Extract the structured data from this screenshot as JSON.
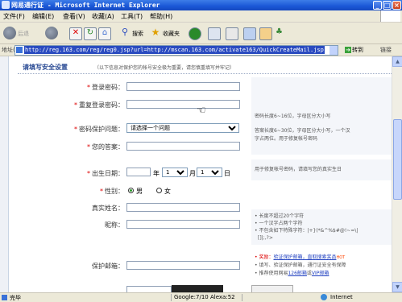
{
  "window": {
    "title": "网易通行证 - Microsoft Internet Explorer"
  },
  "menu": [
    "文件(F)",
    "编辑(E)",
    "查看(V)",
    "收藏(A)",
    "工具(T)",
    "帮助(H)"
  ],
  "toolbar": {
    "back": "后退",
    "search": "搜索",
    "favorites": "收藏夹"
  },
  "address": {
    "label": "地址(D)",
    "url": "http://reg.163.com/reg/reg0.jsp?url=http://mscan.163.com/activate163/QuickCreateMail.jsp",
    "go": "转到",
    "links": "链接"
  },
  "form": {
    "section_title": "请填写安全设置",
    "section_sub": "（以下信息对保护您的帐号安全极为重要，请您慎重填写并牢记）",
    "login_pwd": "登录密码：",
    "repeat_pwd": "重复登录密码：",
    "pwd_hint": "密码长度6~16位，字母区分大小写",
    "question": "密码保护问题：",
    "question_option": "请选择一个问题",
    "answer": "您的答案：",
    "answer_hint1": "答案长度6~30位，字母区分大小写，一个汉",
    "answer_hint2": "字占两位。用于修复帐号密码",
    "birthday": "出生日期：",
    "year_unit": "年",
    "month_value": "1",
    "month_unit": "月",
    "day_value": "1",
    "day_unit": "日",
    "birthday_hint": "用于修复帐号密码，请填写您的真实生日",
    "gender": "性别：",
    "male": "男",
    "female": "女",
    "real_name": "真实姓名：",
    "nickname": "昵称：",
    "nick_hint1": "• 长度不超过20个字符",
    "nick_hint2": "• 一个汉字占两个字符",
    "nick_hint3": "• 不包含如下特殊字符：|+}(*&^%$#@!~=\\|",
    "nick_hint4": "[]|;,?>",
    "backup_email": "保护邮箱：",
    "reward_prefix": "• 奖励：",
    "reward_link": "验证保护邮箱，直取搜索奖品",
    "reward_hot": "HOT",
    "reward_line2": "• 填写、验证保护邮箱，通行证安全有保障",
    "reward_line3_pre": "• 推荐使用网易",
    "reward_line3_link1": "126邮箱",
    "reward_line3_mid": "或",
    "reward_line3_link2": "VIP邮箱"
  },
  "status": {
    "left": "完毕",
    "google": "Google:7/10",
    "alexa": "Alexa:52",
    "zone": "Internet"
  }
}
